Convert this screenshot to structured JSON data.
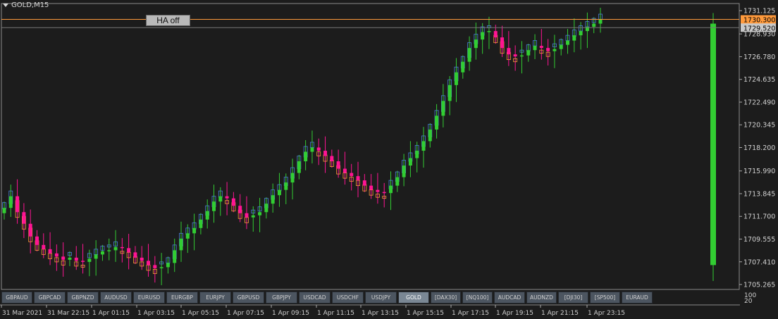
{
  "chart_title": "GOLD,M15",
  "ha_button_label": "HA off",
  "current_price_label": "1730.300",
  "current_price": 1730.3,
  "bid_price_label": "1729.520",
  "bid_price": 1729.52,
  "symbols": [
    "GBPAUD",
    "GBPCAD",
    "GBPNZD",
    "AUDUSD",
    "EURUSD",
    "EURGBP",
    "EURJPY",
    "GBPUSD",
    "GBPJPY",
    "USDCAD",
    "USDCHF",
    "USDJPY",
    "GOLD",
    "[DAX30]",
    "[NQ100]",
    "AUDCAD",
    "AUDNZD",
    "[DJI30]",
    "[SP500]",
    "EURAUD"
  ],
  "active_symbol": "GOLD",
  "indicator_scale": [
    "100",
    "20"
  ],
  "colors": {
    "background": "#1c1c1c",
    "bull_heikin": "#32cd32",
    "bear_heikin": "#ff1493",
    "bull_candle": "#4a7fd6",
    "bear_candle": "#ff9a3c",
    "price_line": "#ff9a3c",
    "axis_text": "#d0d0d0"
  },
  "chart_data": {
    "type": "candlestick",
    "ylim": [
      1704.8,
      1731.8
    ],
    "y_ticks": [
      "1731.125",
      "1728.930",
      "1726.780",
      "1724.635",
      "1722.490",
      "1720.345",
      "1718.200",
      "1715.990",
      "1713.845",
      "1711.700",
      "1709.555",
      "1707.410",
      "1705.265"
    ],
    "x_ticks": [
      "31 Mar 2021",
      "31 Mar 22:15",
      "1 Apr 01:15",
      "1 Apr 03:15",
      "1 Apr 05:15",
      "1 Apr 07:15",
      "1 Apr 09:15",
      "1 Apr 11:15",
      "1 Apr 13:15",
      "1 Apr 15:15",
      "1 Apr 17:15",
      "1 Apr 19:15",
      "1 Apr 21:15",
      "1 Apr 23:15"
    ],
    "close_series": [
      1712.5,
      1713.6,
      1712.1,
      1711.0,
      1709.8,
      1709.0,
      1708.6,
      1708.2,
      1707.9,
      1707.6,
      1707.8,
      1707.5,
      1707.4,
      1707.7,
      1708.1,
      1708.4,
      1708.5,
      1708.8,
      1708.7,
      1708.3,
      1707.8,
      1707.5,
      1707.1,
      1706.8,
      1706.9,
      1707.3,
      1708.5,
      1709.6,
      1710.1,
      1710.6,
      1711.4,
      1712.2,
      1713.1,
      1713.6,
      1713.4,
      1712.7,
      1712.0,
      1711.6,
      1711.8,
      1712.1,
      1712.9,
      1713.7,
      1714.2,
      1714.9,
      1715.8,
      1716.9,
      1717.8,
      1718.2,
      1717.9,
      1717.4,
      1716.9,
      1716.2,
      1715.8,
      1715.5,
      1715.1,
      1714.6,
      1714.2,
      1714.0,
      1713.9,
      1714.6,
      1715.4,
      1716.5,
      1717.2,
      1717.9,
      1718.8,
      1719.9,
      1721.2,
      1722.6,
      1724.1,
      1725.3,
      1726.3,
      1727.6,
      1728.4,
      1729.1,
      1729.2,
      1728.6,
      1727.6,
      1727.0,
      1726.8,
      1726.9,
      1727.4,
      1727.8,
      1727.6,
      1727.3,
      1727.5,
      1727.9,
      1728.3,
      1728.8,
      1729.2,
      1729.6,
      1729.9,
      1730.3
    ]
  }
}
